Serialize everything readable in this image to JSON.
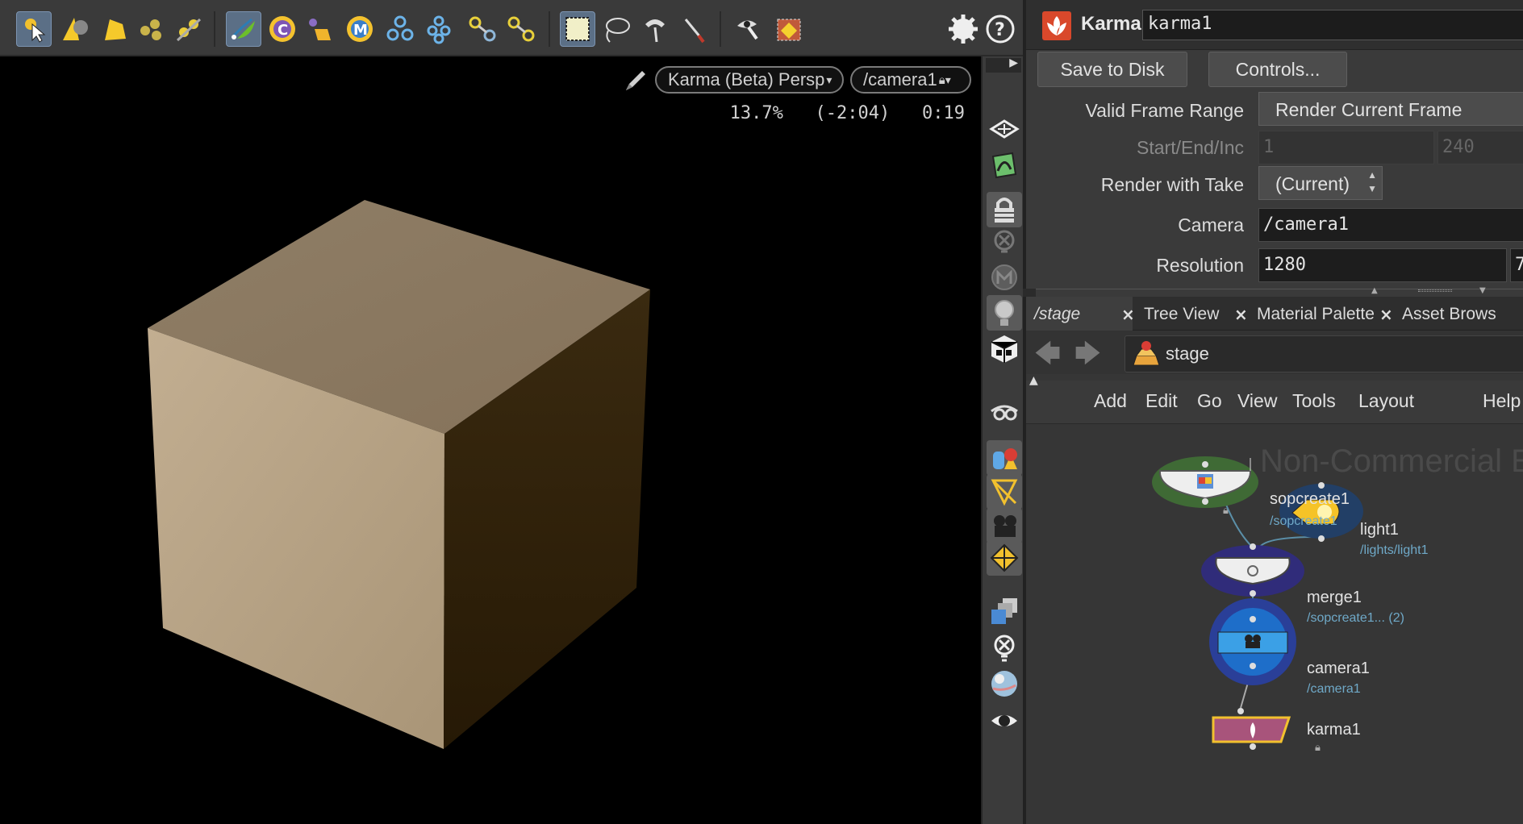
{
  "toolbar": {
    "tools": [
      "select-tool",
      "cone-tool",
      "light-tool",
      "distant-light-tool",
      "spot-light-tool",
      "edit-geometry-tool",
      "character-c-tool",
      "curve-tool",
      "material-m-tool",
      "three-balls-tool",
      "cluster-tool",
      "link-tool",
      "unlink-tool",
      "box-select-tool",
      "lasso-tool",
      "paint-tool",
      "knife-tool",
      "eyedropper-tool",
      "render-region-tool"
    ],
    "help_label": "?"
  },
  "viewport": {
    "renderer_label": "Karma (Beta)  Persp",
    "camera_label": "/camera1",
    "stats": "13.7%   (-2:04)   0:19"
  },
  "param_panel": {
    "node_type": "Karma",
    "node_name": "karma1",
    "save_to_disk": "Save to Disk",
    "controls": "Controls...",
    "rows": {
      "frame_range_label": "Valid Frame Range",
      "frame_range_value": "Render Current Frame",
      "start_end_label": "Start/End/Inc",
      "start_value": "1",
      "end_value": "240",
      "take_label": "Render with Take",
      "take_value": "(Current)",
      "camera_label": "Camera",
      "camera_value": "/camera1",
      "resolution_label": "Resolution",
      "res_x": "1280",
      "res_y": "7"
    }
  },
  "network": {
    "tabs": [
      {
        "label": "/stage",
        "close": "×"
      },
      {
        "label": "Tree View",
        "close": "×"
      },
      {
        "label": "Material Palette",
        "close": "×"
      },
      {
        "label": "Asset Brows",
        "close": ""
      }
    ],
    "path": "stage",
    "menu": [
      "Add",
      "Edit",
      "Go",
      "View",
      "Tools",
      "Layout",
      "Help"
    ],
    "watermark": "Non-Commercial Ed",
    "nodes": {
      "sopcreate": {
        "name": "sopcreate1",
        "path": "/sopcreate1"
      },
      "light": {
        "name": "light1",
        "path": "/lights/light1"
      },
      "merge": {
        "name": "merge1",
        "path": "/sopcreate1... (2)"
      },
      "camera": {
        "name": "camera1",
        "path": "/camera1"
      },
      "karma": {
        "name": "karma1"
      }
    }
  },
  "colors": {
    "cube_top": "#8c7a62",
    "cube_left": "#b7a284",
    "cube_right": "#2e1f08",
    "node_path": "#6fa9c8",
    "karma_node": "#a8547b",
    "light_node": "#f5c327"
  }
}
